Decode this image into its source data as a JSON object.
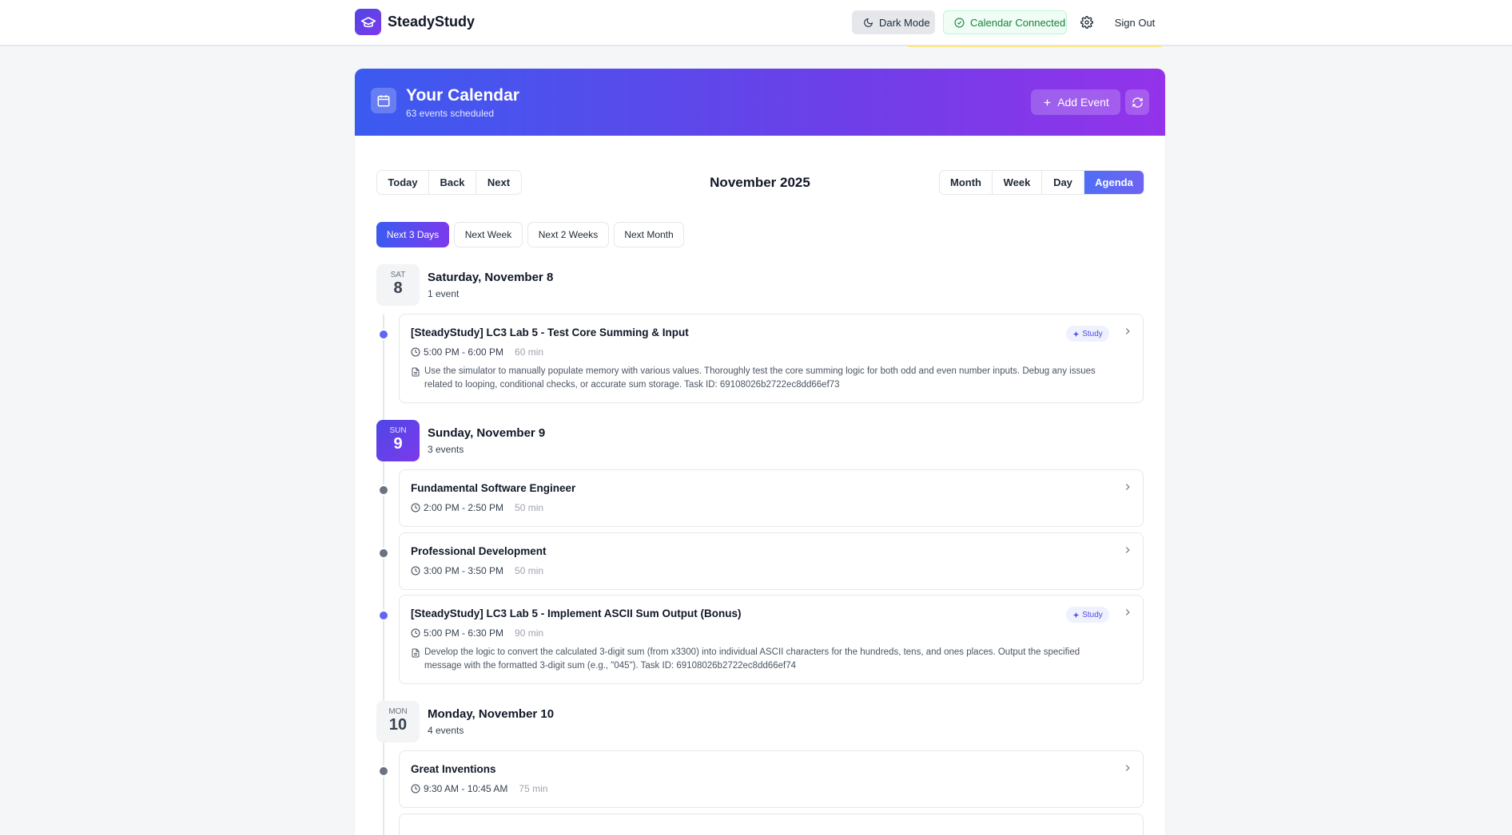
{
  "app": {
    "name": "SteadyStudy"
  },
  "navbar": {
    "dark_mode": "Dark Mode",
    "calendar_connected": "Calendar Connected",
    "sign_out": "Sign Out"
  },
  "header": {
    "title": "Your Calendar",
    "subtitle": "63 events scheduled",
    "add_event": "Add Event"
  },
  "toolbar": {
    "today": "Today",
    "back": "Back",
    "next": "Next",
    "month_label": "November 2025",
    "views": [
      "Month",
      "Week",
      "Day",
      "Agenda"
    ],
    "active_view": "Agenda"
  },
  "ranges": [
    "Next 3 Days",
    "Next Week",
    "Next 2 Weeks",
    "Next Month"
  ],
  "active_range": "Next 3 Days",
  "days": [
    {
      "dow": "SAT",
      "num": "8",
      "title": "Saturday, November 8",
      "count": "1 event",
      "today": false,
      "events": [
        {
          "title": "[SteadyStudy] LC3 Lab 5 - Test Core Summing & Input",
          "time": "5:00 PM - 6:00 PM",
          "duration": "60 min",
          "study": true,
          "description": "Use the simulator to manually populate memory with various values. Thoroughly test the core summing logic for both odd and even number inputs. Debug any issues related to looping, conditional checks, or accurate sum storage. Task ID: 69108026b2722ec8dd66ef73"
        }
      ]
    },
    {
      "dow": "SUN",
      "num": "9",
      "title": "Sunday, November 9",
      "count": "3 events",
      "today": true,
      "events": [
        {
          "title": "Fundamental Software Engineer",
          "time": "2:00 PM - 2:50 PM",
          "duration": "50 min",
          "study": false
        },
        {
          "title": "Professional Development",
          "time": "3:00 PM - 3:50 PM",
          "duration": "50 min",
          "study": false
        },
        {
          "title": "[SteadyStudy] LC3 Lab 5 - Implement ASCII Sum Output (Bonus)",
          "time": "5:00 PM - 6:30 PM",
          "duration": "90 min",
          "study": true,
          "description": "Develop the logic to convert the calculated 3-digit sum (from x3300) into individual ASCII characters for the hundreds, tens, and ones places. Output the specified message with the formatted 3-digit sum (e.g., \"045\"). Task ID: 69108026b2722ec8dd66ef74"
        }
      ]
    },
    {
      "dow": "MON",
      "num": "10",
      "title": "Monday, November 10",
      "count": "4 events",
      "today": false,
      "events": [
        {
          "title": "Great Inventions",
          "time": "9:30 AM - 10:45 AM",
          "duration": "75 min",
          "study": false
        }
      ]
    }
  ],
  "study_tag": "Study",
  "colors": {
    "brand": "#4f46e5",
    "header_start": "#3b5bf0",
    "header_end": "#9333ea",
    "connected": "#15803d"
  }
}
